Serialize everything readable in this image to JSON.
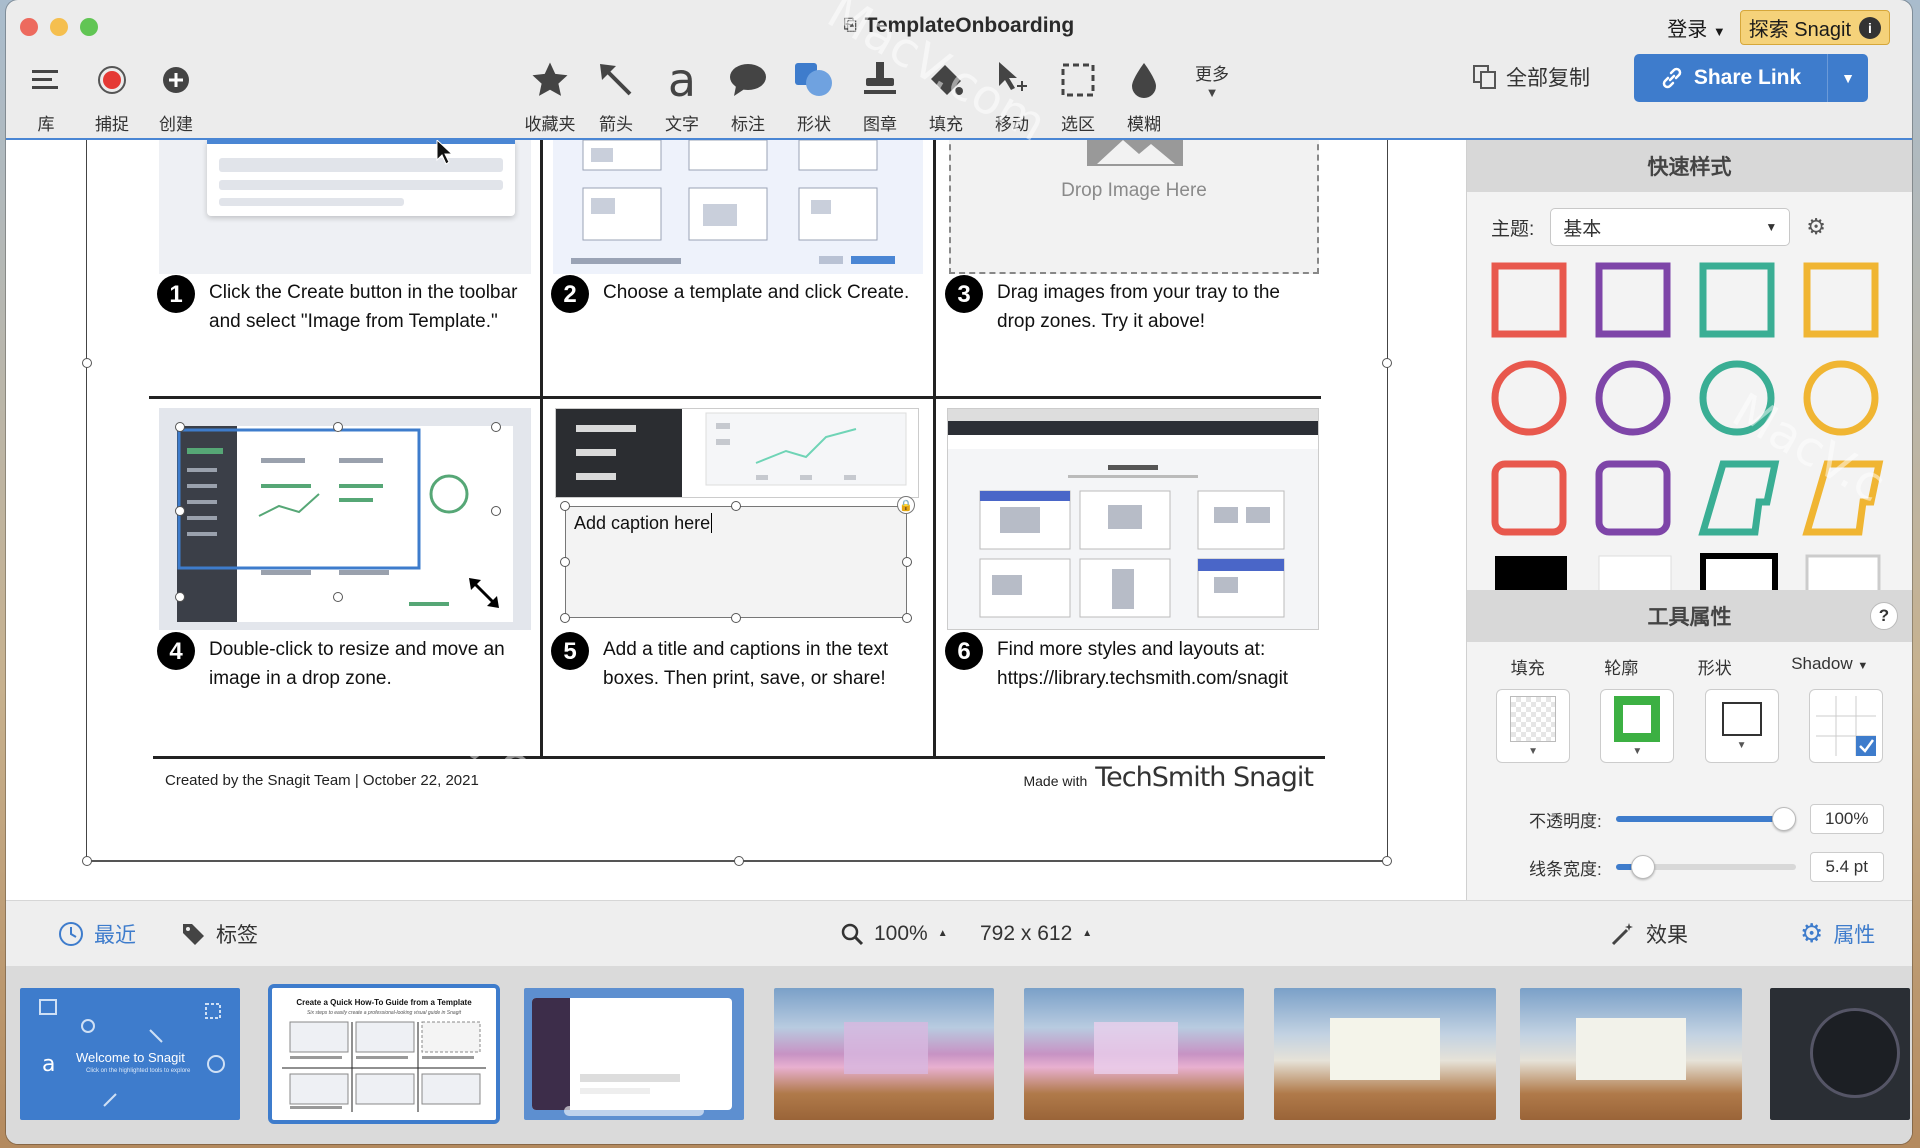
{
  "window": {
    "title": "TemplateOnboarding",
    "login": "登录",
    "explore": "探索 Snagit",
    "info_icon": "info-icon"
  },
  "toolbar": {
    "left": [
      {
        "icon": "menu-icon",
        "label": "库"
      },
      {
        "icon": "record-icon",
        "label": "捕捉"
      },
      {
        "icon": "plus-circle-icon",
        "label": "创建"
      }
    ],
    "tools": [
      {
        "icon": "star-icon",
        "label": "收藏夹"
      },
      {
        "icon": "arrow-icon",
        "label": "箭头"
      },
      {
        "icon": "text-icon",
        "label": "文字"
      },
      {
        "icon": "callout-icon",
        "label": "标注"
      },
      {
        "icon": "shape-icon",
        "label": "形状"
      },
      {
        "icon": "stamp-icon",
        "label": "图章"
      },
      {
        "icon": "fill-icon",
        "label": "填充"
      },
      {
        "icon": "move-icon",
        "label": "移动"
      },
      {
        "icon": "selection-icon",
        "label": "选区"
      },
      {
        "icon": "blur-icon",
        "label": "模糊"
      }
    ],
    "more": "更多",
    "copy_all": "全部复制",
    "share_link": "Share Link"
  },
  "template": {
    "steps": [
      {
        "num": "1",
        "text": "Click the Create button in the toolbar and select \"Image from Template.\""
      },
      {
        "num": "2",
        "text": "Choose a template and click Create."
      },
      {
        "num": "3",
        "text": "Drag images from your tray to the drop zones. Try it above!"
      },
      {
        "num": "4",
        "text": "Double-click to resize and move an image in a drop zone."
      },
      {
        "num": "5",
        "text": "Add a title and captions in the text boxes. Then print, save, or share!"
      },
      {
        "num": "6",
        "text": "Find more styles and layouts at: https://library.techsmith.com/snagit"
      }
    ],
    "drop_image": "Drop Image Here",
    "caption_placeholder": "Add caption here",
    "footer_left": "Created by the Snagit Team  |   October 22, 2021",
    "footer_made": "Made with",
    "footer_brand": "TechSmith Snagit"
  },
  "panel": {
    "quick_styles": "快速样式",
    "theme_label": "主题:",
    "theme_value": "基本",
    "tool_props": "工具属性",
    "help": "?",
    "prop_labels": [
      "填充",
      "轮廓",
      "形状",
      "Shadow"
    ],
    "opacity_label": "不透明度:",
    "opacity_value": "100%",
    "opacity_fraction": 1.0,
    "width_label": "线条宽度:",
    "width_value": "5.4 pt",
    "width_fraction": 0.1,
    "swatch_colors": [
      "#e8584d",
      "#7e45a8",
      "#3aae94",
      "#f0b532"
    ]
  },
  "statusbar": {
    "recent": "最近",
    "tags": "标签",
    "zoom": "100%",
    "dimensions": "792 x 612",
    "effects": "效果",
    "properties": "属性"
  },
  "tray": {
    "welcome_title": "Welcome to Snagit",
    "welcome_sub": "Click on the highlighted tools to explore",
    "guide_title": "Create a Quick How-To Guide from a Template",
    "guide_sub": "Six steps to easily create a professional-looking visual guide in Snagit"
  }
}
